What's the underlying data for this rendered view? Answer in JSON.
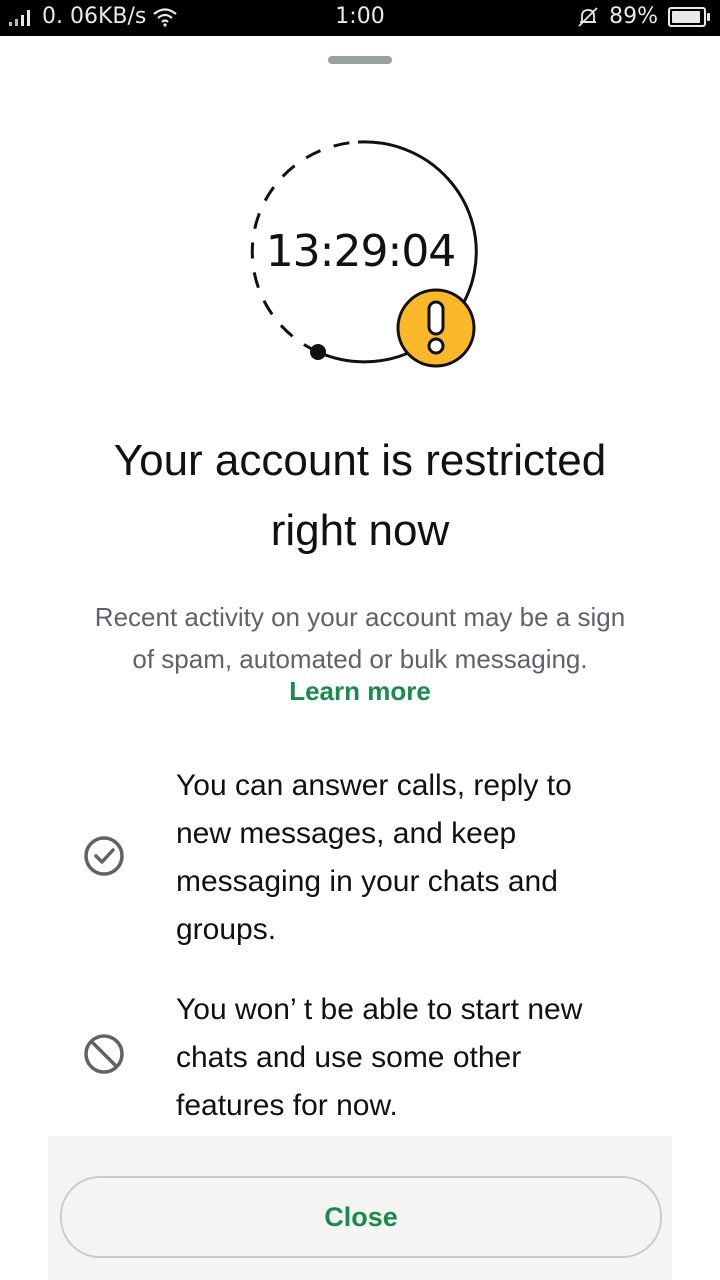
{
  "status_bar": {
    "network_speed": "0. 06KB/s",
    "time": "1:00",
    "battery": "89%"
  },
  "timer": "13:29:04",
  "title_line1": "Your account is restricted",
  "title_line2": "right now",
  "subtitle_line1": "Recent activity on your account may be a sign",
  "subtitle_line2": "of spam,  automated or bulk messaging.",
  "learn_more": "Learn more",
  "allowed": {
    "line1": "You can answer calls,  reply to",
    "line2": "new messages,  and keep",
    "line3": "messaging in your chats and",
    "line4": "groups."
  },
  "restricted": {
    "line1": "You won’ t be able to start new",
    "line2": "chats and use some other",
    "line3": "features for now."
  },
  "close_label": "Close",
  "colors": {
    "accent_green": "#1c8a4c",
    "warning_yellow": "#f9b829",
    "icon_gray": "#5f6368"
  },
  "icons": [
    "signal-icon",
    "wifi-icon",
    "mute-bell-icon",
    "battery-icon",
    "warning-icon",
    "check-circle-icon",
    "block-icon"
  ]
}
